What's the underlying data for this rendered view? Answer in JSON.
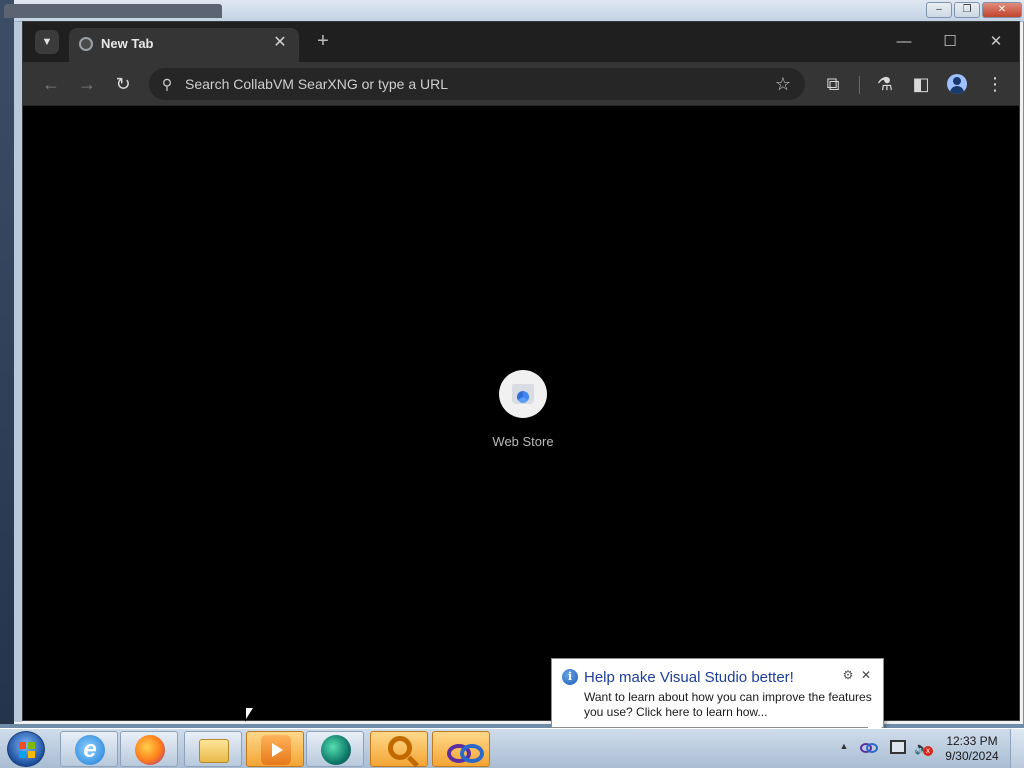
{
  "browser": {
    "tab": {
      "title": "New Tab"
    },
    "omnibox": {
      "placeholder": "Search CollabVM SearXNG or type a URL"
    },
    "new_tab_page": {
      "shortcuts": [
        {
          "label": "Web Store",
          "icon": "web-store-icon"
        }
      ]
    },
    "icons": {
      "tab_search": "chevron-down-icon",
      "tab_close": "close-icon",
      "new_tab": "plus-icon",
      "back": "arrow-left-icon",
      "forward": "arrow-right-icon",
      "reload": "reload-icon",
      "search": "search-icon",
      "bookmark": "star-icon",
      "extensions": "puzzle-icon",
      "labs": "flask-icon",
      "side_panel": "side-panel-icon",
      "profile": "avatar-icon",
      "menu": "kebab-menu-icon"
    }
  },
  "notification": {
    "title": "Help make Visual Studio better!",
    "text": "Want to learn about how you can improve the features you use? Click here to learn how...",
    "icon": "info-icon"
  },
  "taskbar": {
    "apps": [
      {
        "name": "internet-explorer"
      },
      {
        "name": "firefox"
      },
      {
        "name": "windows-explorer"
      },
      {
        "name": "windows-media-player"
      },
      {
        "name": "globe-app"
      },
      {
        "name": "search-app"
      },
      {
        "name": "visual-studio"
      }
    ],
    "clock": {
      "time": "12:33 PM",
      "date": "9/30/2024"
    }
  },
  "colors": {
    "chrome_dark": "#1f1f1f",
    "toolbar": "#353535",
    "omnibox": "#262626",
    "balloon_title": "#1e3f9a"
  }
}
